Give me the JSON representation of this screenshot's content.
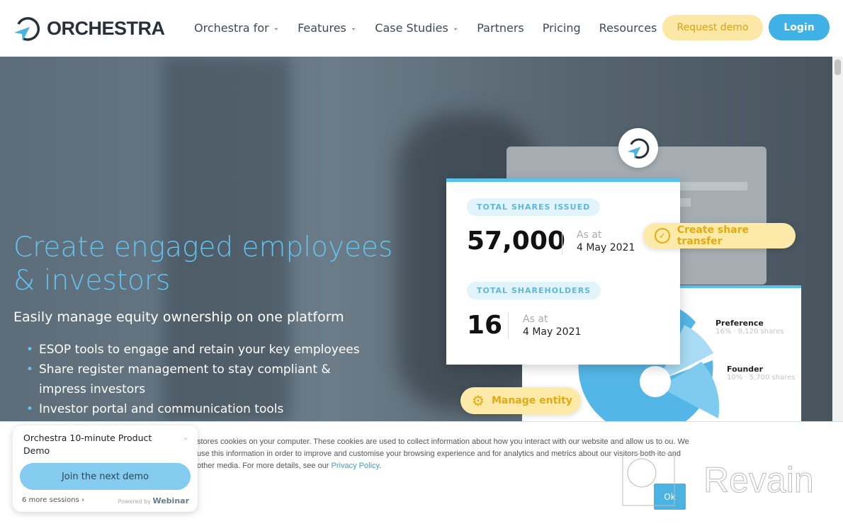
{
  "header": {
    "brand": "ORCHESTRA",
    "nav": [
      {
        "label": "Orchestra for",
        "dropdown": true
      },
      {
        "label": "Features",
        "dropdown": true
      },
      {
        "label": "Case Studies",
        "dropdown": true
      },
      {
        "label": "Partners",
        "dropdown": false
      },
      {
        "label": "Pricing",
        "dropdown": false
      },
      {
        "label": "Resources",
        "dropdown": true
      }
    ],
    "request_demo": "Request demo",
    "login": "Login"
  },
  "hero": {
    "title": "Create engaged employees & investors",
    "subtitle": "Easily manage equity ownership on one platform",
    "bullets": [
      "ESOP tools to engage and retain your key employees",
      "Share register management to stay compliant & impress investors",
      "Investor portal and communication tools"
    ]
  },
  "illustration": {
    "shares_label": "TOTAL SHARES ISSUED",
    "shares_value": "57,000",
    "shares_asat": "As at",
    "shares_date": "4 May 2021",
    "holders_label": "TOTAL SHAREHOLDERS",
    "holders_value": "16",
    "holders_asat": "As at",
    "holders_date": "4 May 2021",
    "create_transfer": "Create share transfer",
    "manage_entity": "Manage entity",
    "legend": [
      {
        "name": "Preference",
        "detail": "16% · 9,120 shares"
      },
      {
        "name": "Founder",
        "detail": "10% · 5,700 shares"
      }
    ]
  },
  "cookie": {
    "text": "stores cookies on your computer. These cookies are used to collect information about how you interact with our website and allow us to ou. We use this information in order to improve and customise your browsing experience and for analytics and metrics about our visitors both ite and other media. For more details, see our",
    "link": "Privacy Policy",
    "ok": "Ok"
  },
  "widget": {
    "title": "Orchestra 10-minute Product Demo",
    "button": "Join the next demo",
    "more": "6 more sessions ›",
    "powered": "Powered by",
    "brand": "Webinar"
  },
  "watermark": "Revain",
  "colors": {
    "accent": "#3fb1e5",
    "yellow": "#fde7a6",
    "title": "#62c3ee"
  }
}
